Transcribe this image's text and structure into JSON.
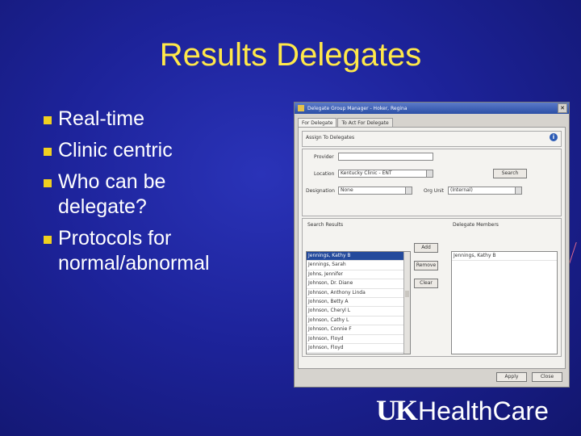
{
  "slide": {
    "title": "Results Delegates",
    "bullets": [
      "Real-time",
      "Clinic centric",
      "Who can be",
      "delegate?",
      "Protocols for",
      "normal/abnormal"
    ]
  },
  "window": {
    "title": "Delegate Group Manager - Hoker, Regina",
    "tabs": [
      "For Delegate",
      "To Act For Delegate"
    ],
    "section_header": "Assign To Delegates",
    "labels": {
      "provider": "Provider",
      "location": "Location",
      "designation": "Designation",
      "org_unit": "Org Unit",
      "search_results": "Search Results",
      "delegate_members": "Delegate Members"
    },
    "location_value": "Kentucky Clinic - ENT",
    "designation_value": "None",
    "org_unit_value": "(Internal)",
    "buttons": {
      "search": "Search",
      "add": "Add",
      "remove": "Remove",
      "clear": "Clear",
      "apply": "Apply",
      "close": "Close"
    },
    "search_results": [
      "Jennings, Kathy B",
      "Jennings, Sarah",
      "Johns, Jennifer",
      "Johnson, Dr. Diane",
      "Johnson, Anthony Linda",
      "Johnson, Betty A",
      "Johnson, Cheryl L",
      "Johnson, Cathy L",
      "Johnson, Connie F",
      "Johnson, Floyd",
      "Johnson, Floyd"
    ],
    "delegate_members": [
      "Jennings, Kathy B"
    ]
  },
  "logo": {
    "uk": "UK",
    "hc": "HealthCare"
  }
}
